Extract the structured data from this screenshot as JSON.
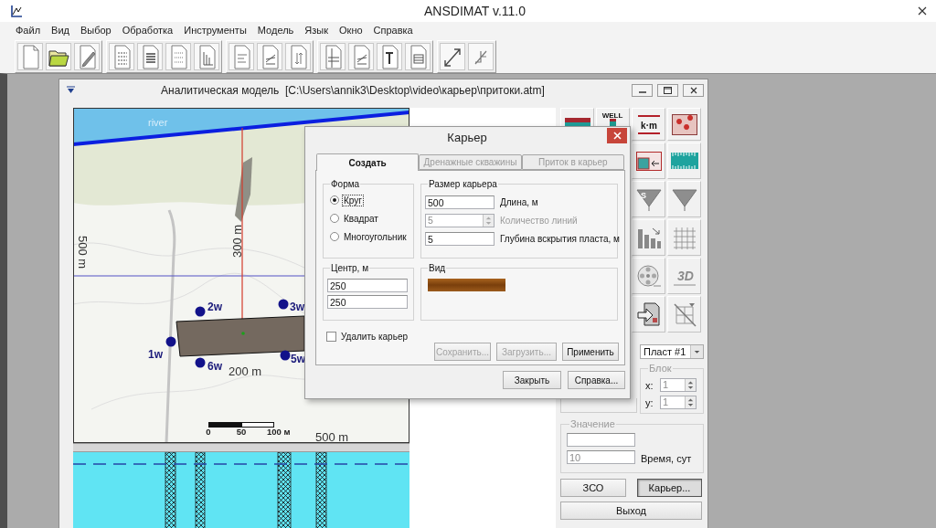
{
  "app": {
    "title": "ANSDIMAT v.11.0"
  },
  "menu": [
    "Файл",
    "Вид",
    "Выбор",
    "Обработка",
    "Инструменты",
    "Модель",
    "Язык",
    "Окно",
    "Справка"
  ],
  "model_window": {
    "title": "Аналитическая модель  [C:\\Users\\annik3\\Desktop\\video\\карьер\\притоки.atm]"
  },
  "map": {
    "river_label": "river",
    "distance_labels": [
      "500 m",
      "300 m",
      "200 m",
      "500 m"
    ],
    "wells": [
      "1w",
      "2w",
      "3w",
      "5w",
      "6w"
    ],
    "scale_labels": [
      "0",
      "50",
      "100 м"
    ]
  },
  "tools": [
    {
      "kind": "section",
      "disabled": false
    },
    {
      "kind": "well",
      "text": "WELL",
      "disabled": false
    },
    {
      "kind": "km",
      "text": "k·m",
      "disabled": false
    },
    {
      "kind": "map",
      "disabled": false
    },
    {
      "kind": "window",
      "disabled": false
    },
    {
      "kind": "ruler",
      "disabled": false
    },
    {
      "kind": "funnel",
      "text": "S",
      "disabled": true
    },
    {
      "kind": "funnel",
      "disabled": true
    },
    {
      "kind": "chart",
      "disabled": true
    },
    {
      "kind": "grid",
      "disabled": true
    },
    {
      "kind": "reel",
      "disabled": true
    },
    {
      "kind": "threed",
      "text": "3D",
      "disabled": true
    },
    {
      "kind": "import",
      "disabled": false
    },
    {
      "kind": "crossed",
      "disabled": true
    }
  ],
  "layer_select": {
    "value": "Пласт #1"
  },
  "block_group": {
    "title": "Блок",
    "disabled": true,
    "fields": [
      {
        "label": "x:",
        "value": "1"
      },
      {
        "label": "y:",
        "value": "1"
      }
    ]
  },
  "value_group": {
    "title": "Значение",
    "disabled": true,
    "time_value": "10",
    "time_label": "Время, сут"
  },
  "panel_buttons": [
    {
      "label": "ЗСО",
      "pressed": false
    },
    {
      "label": "Карьер...",
      "pressed": true
    }
  ],
  "exit_button": {
    "label": "Выход"
  },
  "dialog": {
    "title": "Карьер",
    "tabs": [
      {
        "label": "Создать",
        "selected": true,
        "disabled": false
      },
      {
        "label": "Дренажные скважины",
        "selected": false,
        "disabled": true
      },
      {
        "label": "Приток в карьер",
        "selected": false,
        "disabled": true
      }
    ],
    "shape_group": {
      "title": "Форма",
      "options": [
        {
          "label": "Круг",
          "selected": true
        },
        {
          "label": "Квадрат",
          "selected": false
        },
        {
          "label": "Многоугольник",
          "selected": false
        }
      ]
    },
    "size_group": {
      "title": "Размер карьера",
      "fields": [
        {
          "kind": "text",
          "value": "500",
          "label": "Длина, м",
          "disabled": false
        },
        {
          "kind": "spin",
          "value": "5",
          "label": "Количество линий",
          "disabled": true
        },
        {
          "kind": "text",
          "value": "5",
          "label": "Глубина вскрытия пласта, м",
          "disabled": false
        }
      ]
    },
    "center_group": {
      "title": "Центр, м",
      "fields": [
        "250",
        "250"
      ]
    },
    "view_group": {
      "title": "Вид"
    },
    "delete_checkbox": {
      "label": "Удалить карьер",
      "checked": false
    },
    "actions": [
      {
        "label": "Сохранить...",
        "disabled": true
      },
      {
        "label": "Загрузить...",
        "disabled": true
      },
      {
        "label": "Применить",
        "disabled": false
      }
    ],
    "buttons": [
      "Закрыть",
      "Справка..."
    ]
  }
}
